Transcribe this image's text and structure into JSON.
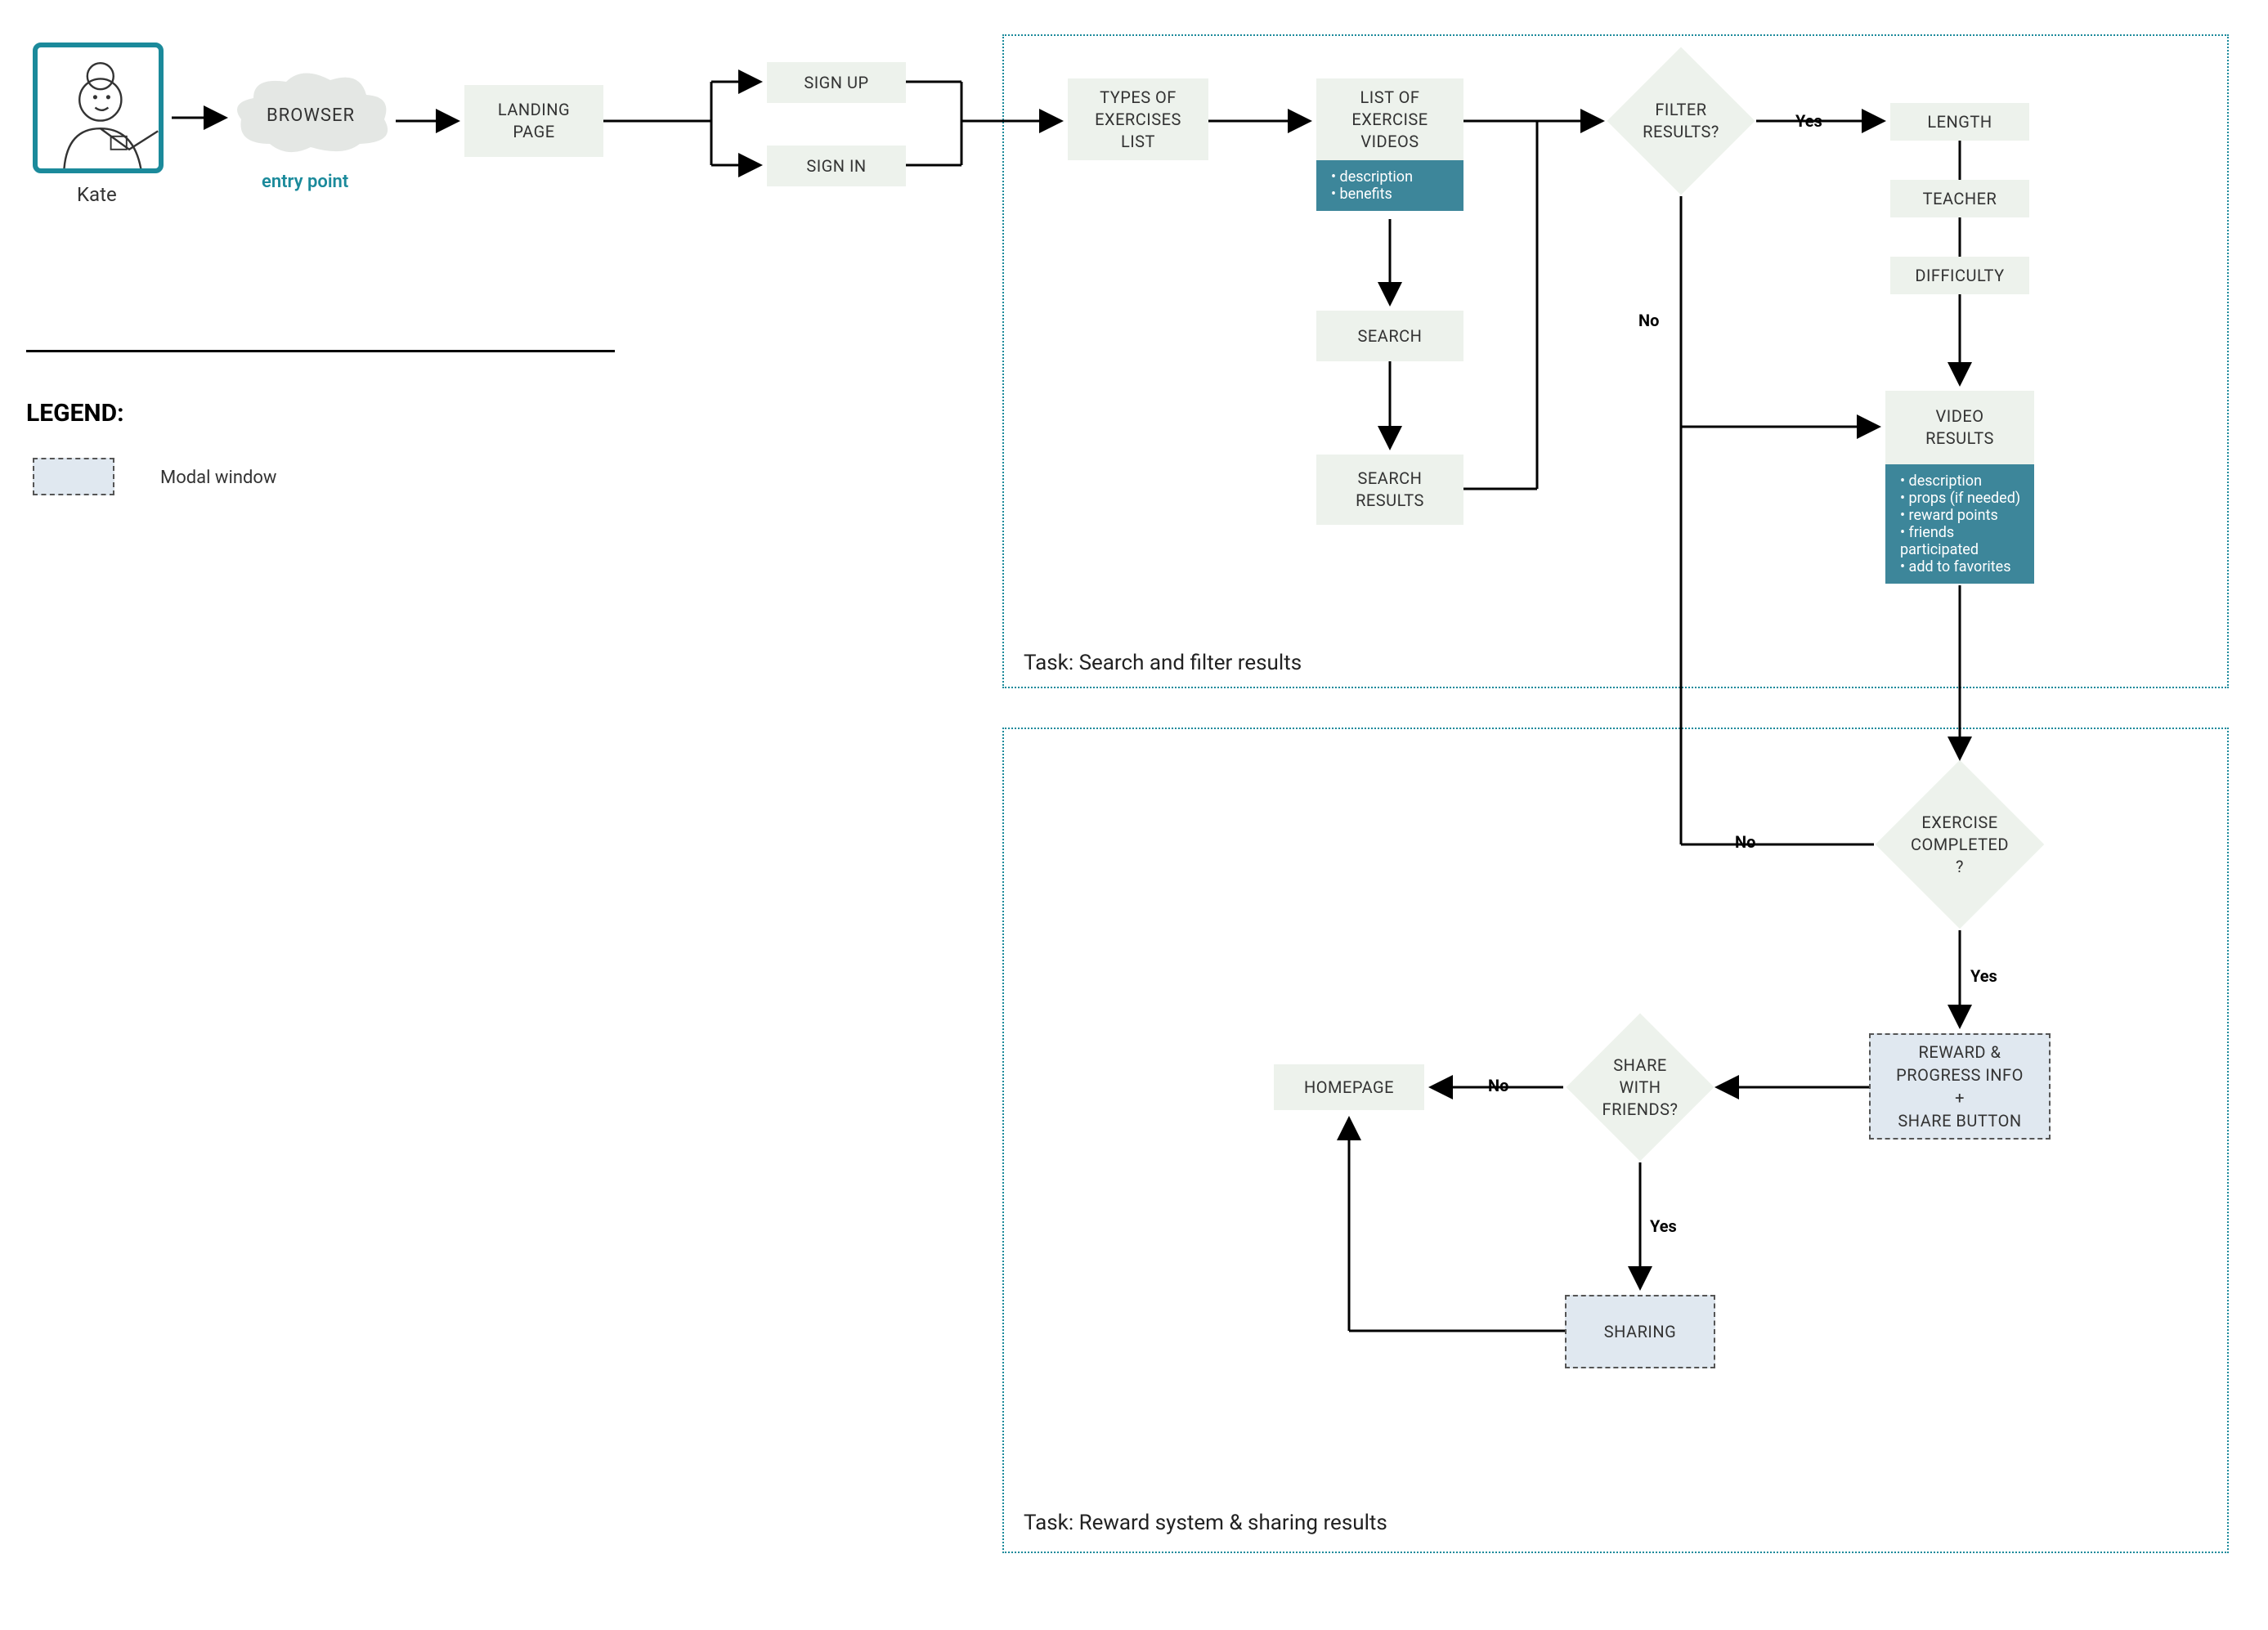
{
  "persona": {
    "name": "Kate",
    "entry_point": "entry point"
  },
  "nodes": {
    "browser": "BROWSER",
    "landing": "LANDING\nPAGE",
    "signup": "SIGN UP",
    "signin": "SIGN IN",
    "types": "TYPES OF\nEXERCISES\nLIST",
    "list_videos": "LIST OF\nEXERCISE\nVIDEOS",
    "search": "SEARCH",
    "search_results": "SEARCH\nRESULTS",
    "filter_q": "FILTER\nRESULTS?",
    "length": "LENGTH",
    "teacher": "TEACHER",
    "difficulty": "DIFFICULTY",
    "video_results": "VIDEO\nRESULTS",
    "exercise_q": "EXERCISE\nCOMPLETED\n?",
    "reward_modal": "REWARD &\nPROGRESS INFO\n+\nSHARE BUTTON",
    "share_q": "SHARE\nWITH\nFRIENDS?",
    "sharing": "SHARING",
    "homepage": "HOMEPAGE"
  },
  "details": {
    "list_videos": [
      "description",
      "benefits"
    ],
    "video_results": [
      "description",
      "props (if needed)",
      "reward points",
      "friends participated",
      "add to favorites"
    ]
  },
  "labels": {
    "yes": "Yes",
    "no": "No"
  },
  "tasks": {
    "search": "Task: Search and filter results",
    "reward": "Task: Reward system & sharing results"
  },
  "legend": {
    "title": "LEGEND:",
    "modal": "Modal window"
  }
}
